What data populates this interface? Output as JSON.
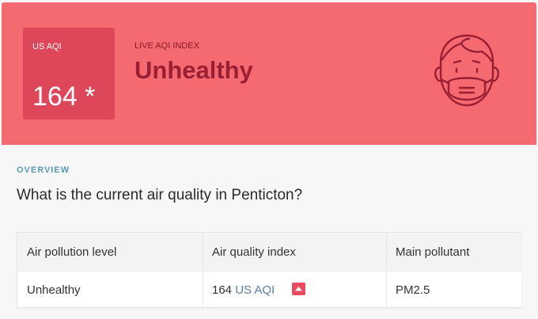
{
  "banner": {
    "aqi_label": "US AQI",
    "aqi_value": "164 *",
    "live_label": "LIVE AQI INDEX",
    "status": "Unhealthy",
    "icon": "face-mask-icon"
  },
  "overview": {
    "section_label": "OVERVIEW",
    "question": "What is the current air quality in Penticton?"
  },
  "table": {
    "headers": [
      "Air pollution level",
      "Air quality index",
      "Main pollutant"
    ],
    "row": {
      "level": "Unhealthy",
      "aqi_number": "164",
      "aqi_unit": "US AQI",
      "trend_icon": "arrow-up-icon",
      "pollutant": "PM2.5"
    }
  },
  "colors": {
    "banner": "#f46a70",
    "aqi_box": "#de4759",
    "status_text": "#9a1f33",
    "accent_blue": "#5a9ab0"
  }
}
